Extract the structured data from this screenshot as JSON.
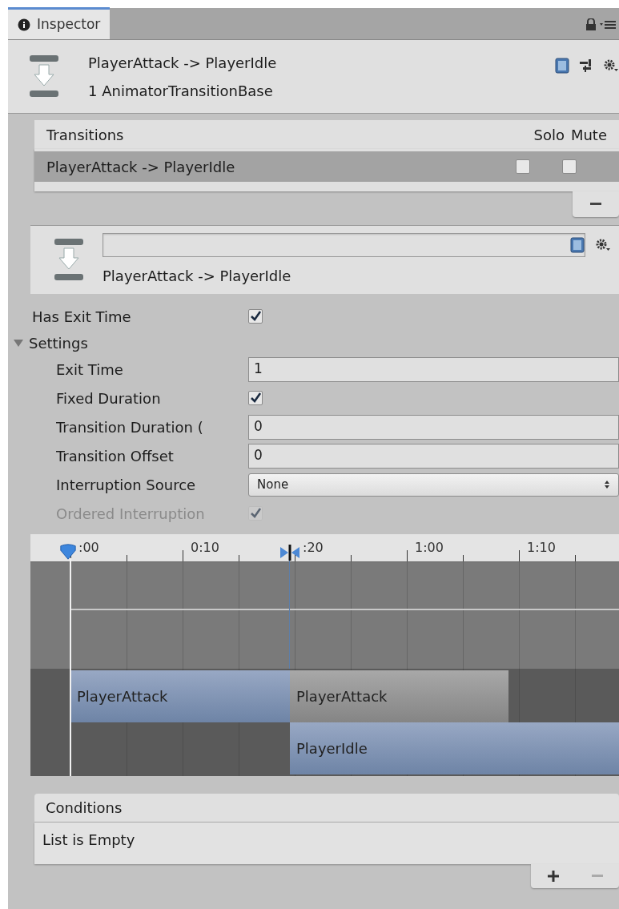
{
  "tab": {
    "label": "Inspector",
    "selected": true
  },
  "header": {
    "title": "PlayerAttack -> PlayerIdle",
    "subtitle": "1 AnimatorTransitionBase"
  },
  "transitions": {
    "columns": [
      "Transitions",
      "Solo",
      "Mute"
    ],
    "rows": [
      {
        "name": "PlayerAttack -> PlayerIdle",
        "selected": true,
        "solo": false,
        "mute": false
      }
    ]
  },
  "transition": {
    "name": "PlayerAttack -> PlayerIdle"
  },
  "has_exit_time": {
    "label": "Has Exit Time",
    "checked": true
  },
  "settings": {
    "label": "Settings",
    "expanded": true,
    "fields": [
      {
        "kind": "number",
        "label": "Exit Time",
        "value": "1",
        "disabled": false
      },
      {
        "kind": "checkbox",
        "label": "Fixed Duration",
        "checked": true,
        "disabled": false
      },
      {
        "kind": "number",
        "label": "Transition Duration (",
        "value": "0",
        "disabled": false
      },
      {
        "kind": "number",
        "label": "Transition Offset",
        "value": "0",
        "disabled": false
      },
      {
        "kind": "dropdown",
        "label": "Interruption Source",
        "value": "None",
        "disabled": false
      },
      {
        "kind": "checkbox",
        "label": "Ordered Interruption",
        "checked": true,
        "disabled": true
      }
    ]
  },
  "timeline": {
    "ticks": [
      ":00",
      "0:10",
      ":20",
      "1:00",
      "1:10"
    ],
    "clips": [
      {
        "kind": "source",
        "label": "PlayerAttack"
      },
      {
        "kind": "source_rest",
        "label": "PlayerAttack"
      },
      {
        "kind": "destination",
        "label": "PlayerIdle"
      }
    ]
  },
  "conditions": {
    "title": "Conditions",
    "empty_text": "List is Empty"
  }
}
